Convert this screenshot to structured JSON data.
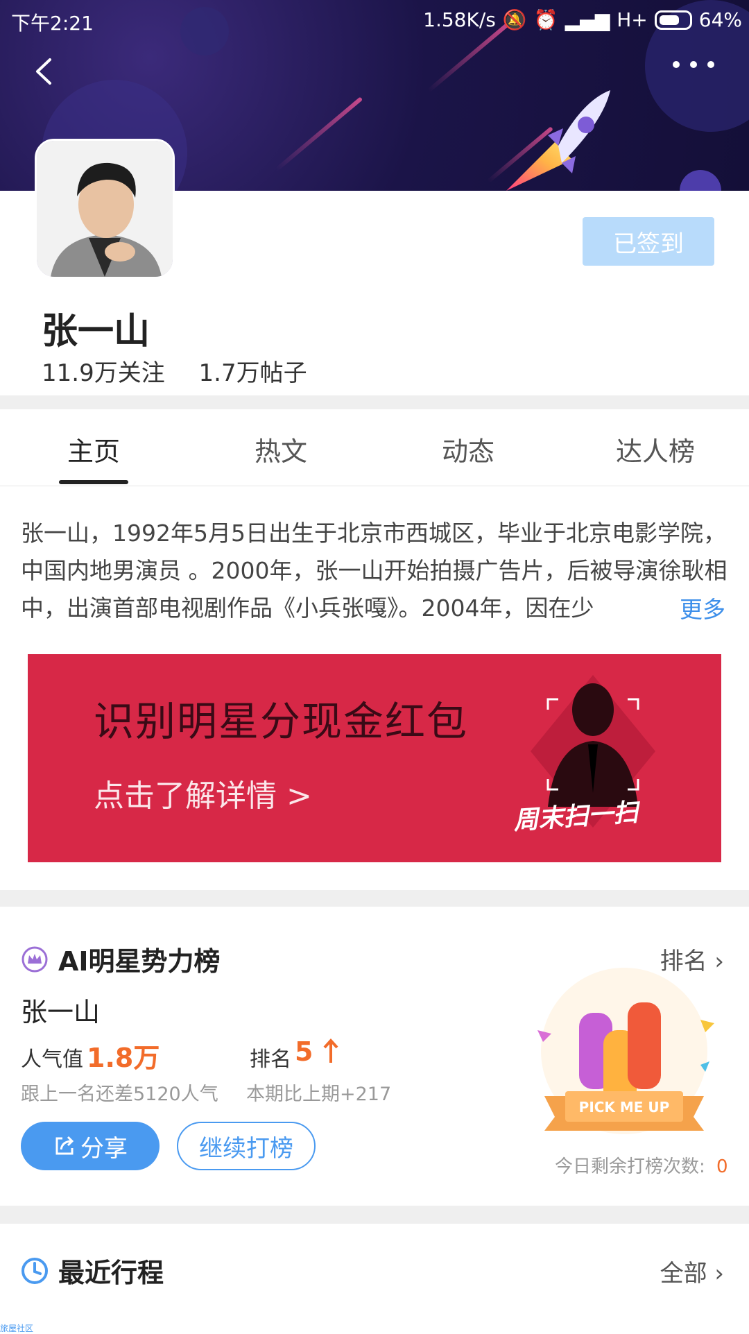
{
  "status_bar": {
    "time": "下午2:21",
    "network_speed": "1.58K/s",
    "signal_type": "H+",
    "battery": "64%"
  },
  "header": {
    "back_icon": "chevron-left-icon",
    "more_icon": "more-dots-icon"
  },
  "profile": {
    "name": "张一山",
    "followers": "11.9万关注",
    "posts": "1.7万帖子",
    "checkin_label": "已签到"
  },
  "tabs": [
    {
      "label": "主页",
      "active": true
    },
    {
      "label": "热文",
      "active": false
    },
    {
      "label": "动态",
      "active": false
    },
    {
      "label": "达人榜",
      "active": false
    }
  ],
  "bio": {
    "text": "张一山，1992年5月5日出生于北京市西城区，毕业于北京电影学院，中国内地男演员 。2000年，张一山开始拍摄广告片，后被导演徐耿相中，出演首部电视剧作品《小兵张嘎》。2004年，因在少",
    "more_label": "更多"
  },
  "promo": {
    "title": "识别明星分现金红包",
    "subtitle": "点击了解详情 >",
    "tag": "周末扫一扫"
  },
  "ai_rank": {
    "title": "AI明星势力榜",
    "rank_link": "排名",
    "star_name": "张一山",
    "popularity_label": "人气值",
    "popularity_value": "1.8万",
    "rank_label": "排名",
    "rank_value": "5",
    "gap_text": "跟上一名还差5120人气",
    "period_text": "本期比上期+217",
    "share_label": "分享",
    "continue_label": "继续打榜",
    "pickme_text": "PICK ME UP",
    "remaining_label": "今日剩余打榜次数:",
    "remaining_value": "0"
  },
  "schedule": {
    "title": "最近行程",
    "all_link": "全部"
  },
  "watermark": "旅屋社区",
  "colors": {
    "accent_blue": "#4a9af0",
    "orange": "#f26c2a",
    "promo_red": "#d72847",
    "banner_purple": "#1b1448"
  }
}
